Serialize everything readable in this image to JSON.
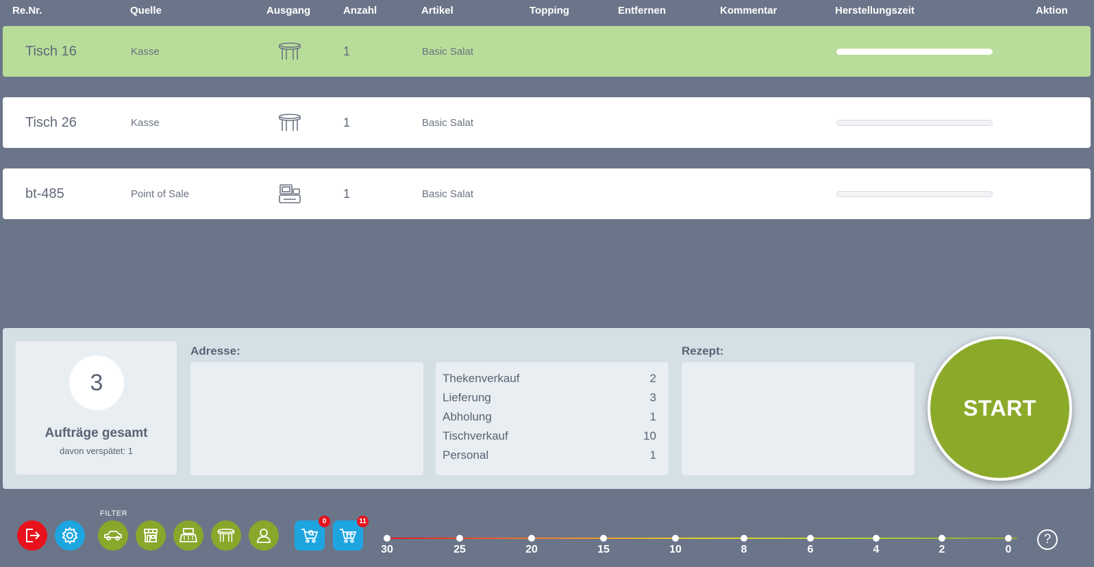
{
  "header": {
    "renr": "Re.Nr.",
    "quelle": "Quelle",
    "ausgang": "Ausgang",
    "anzahl": "Anzahl",
    "artikel": "Artikel",
    "topping": "Topping",
    "entfernen": "Entfernen",
    "kommentar": "Kommentar",
    "herstellungszeit": "Herstellungszeit",
    "aktion": "Aktion"
  },
  "orders": [
    {
      "renr": "Tisch 16",
      "quelle": "Kasse",
      "ausgang_icon": "table-icon",
      "anzahl": "1",
      "artikel": "Basic Salat",
      "progress": 1.0,
      "active": true
    },
    {
      "renr": "Tisch 26",
      "quelle": "Kasse",
      "ausgang_icon": "table-icon",
      "anzahl": "1",
      "artikel": "Basic Salat",
      "progress": 0.0,
      "active": false
    },
    {
      "renr": "bt-485",
      "quelle": "Point of Sale",
      "ausgang_icon": "pos-terminal-icon",
      "anzahl": "1",
      "artikel": "Basic Salat",
      "progress": 0.0,
      "active": false
    }
  ],
  "summary": {
    "count": "3",
    "title": "Aufträge gesamt",
    "subtitle": "davon verspätet: 1"
  },
  "address": {
    "label": "Adresse:"
  },
  "recipe": {
    "label": "Rezept:"
  },
  "stats": [
    {
      "label": "Thekenverkauf",
      "value": "2"
    },
    {
      "label": "Lieferung",
      "value": "3"
    },
    {
      "label": "Abholung",
      "value": "1"
    },
    {
      "label": "Tischverkauf",
      "value": "10"
    },
    {
      "label": "Personal",
      "value": "1"
    }
  ],
  "start_label": "START",
  "toolbar": {
    "filter_label": "FILTER",
    "cart_badge_1": "0",
    "cart_badge_2": "11",
    "icons": [
      "logout-icon",
      "settings-icon",
      "car-icon",
      "store-icon",
      "register-icon",
      "table-icon",
      "person-icon",
      "cart-search-icon",
      "cart-icon",
      "help-icon"
    ]
  },
  "timeline": [
    "30",
    "25",
    "20",
    "15",
    "10",
    "8",
    "6",
    "4",
    "2",
    "0"
  ],
  "help_label": "?",
  "colors": {
    "background": "#6b7589",
    "active_row": "#b8dd9a",
    "start": "#8caa2a",
    "logout": "#e8121c",
    "blue": "#1da5e0",
    "filter_green": "#89a72a"
  }
}
